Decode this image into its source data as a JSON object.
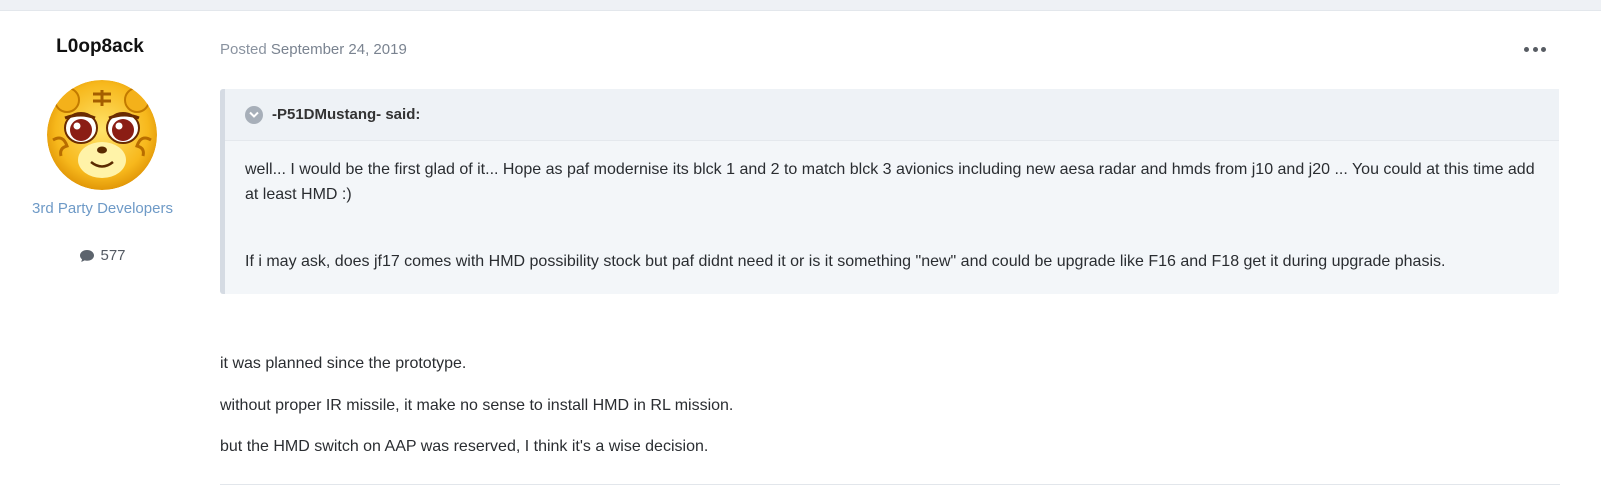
{
  "author": {
    "name": "L0op8ack",
    "group": "3rd Party Developers",
    "post_count": "577",
    "avatar_icon": "tiger-cub-avatar",
    "post_count_icon": "comment-icon"
  },
  "post": {
    "posted_prefix": "Posted",
    "posted_date": "September 24, 2019",
    "menu_icon": "more-horizontal-icon"
  },
  "quote": {
    "toggle_icon": "chevron-down-icon",
    "author": "-P51DMustang- said:",
    "paragraphs": [
      "well... I would be the first glad of it... Hope as paf modernise its blck 1 and 2 to match blck 3 avionics including new aesa radar and hmds from j10 and j20 ... You could at this time add at least HMD :)",
      "If i may ask, does jf17 comes with HMD possibility stock but paf didnt need it or is it something \"new\" and could be upgrade like F16 and F18 get it during upgrade phasis."
    ]
  },
  "reply": {
    "paragraphs": [
      "it was planned since the prototype.",
      "without proper IR missile, it make no sense to install HMD in RL mission.",
      "but the HMD switch on AAP was reserved, I think it's a wise decision."
    ]
  },
  "colors": {
    "group": "#6e9ac7",
    "quote_bg": "#f3f6f9",
    "quote_border": "#d5dbe3"
  }
}
